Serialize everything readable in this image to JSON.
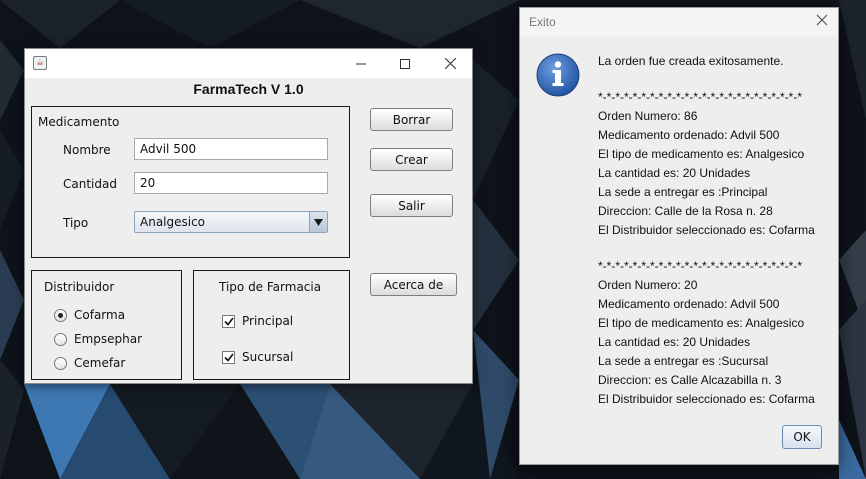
{
  "main_window": {
    "title": "FarmaTech V 1.0",
    "medicamento_group": {
      "title": "Medicamento",
      "nombre_label": "Nombre",
      "nombre_value": "Advil 500",
      "cantidad_label": "Cantidad",
      "cantidad_value": "20",
      "tipo_label": "Tipo",
      "tipo_value": "Analgesico"
    },
    "buttons": {
      "borrar": "Borrar",
      "crear": "Crear",
      "salir": "Salir",
      "acerca_de": "Acerca de"
    },
    "distribuidor_group": {
      "title": "Distribuidor",
      "options": [
        {
          "label": "Cofarma",
          "selected": true
        },
        {
          "label": "Empsephar",
          "selected": false
        },
        {
          "label": "Cemefar",
          "selected": false
        }
      ]
    },
    "farmacia_group": {
      "title": "Tipo de Farmacia",
      "options": [
        {
          "label": "Principal",
          "checked": true
        },
        {
          "label": "Sucursal",
          "checked": true
        }
      ]
    }
  },
  "dialog": {
    "title": "Exito",
    "icon": "information-icon",
    "lines": [
      "La orden fue creada exitosamente.",
      "*-*-*-*-*-*-*-*-*-*-*-*-*-*-*-*-*-*-*-*-*-*-*-*",
      "Orden Numero: 86",
      "Medicamento ordenado: Advil 500",
      "El tipo de medicamento es: Analgesico",
      "La cantidad es: 20 Unidades",
      "La sede a entregar es :Principal",
      "Direccion: Calle de la Rosa n. 28",
      "El Distribuidor seleccionado es: Cofarma",
      "*-*-*-*-*-*-*-*-*-*-*-*-*-*-*-*-*-*-*-*-*-*-*-*",
      "Orden Numero: 20",
      "Medicamento ordenado: Advil 500",
      "El tipo de medicamento es: Analgesico",
      "La cantidad es: 20 Unidades",
      "La sede a entregar es :Sucursal",
      "Direccion: es Calle Alcazabilla n. 3",
      "El Distribuidor seleccionado es: Cofarma"
    ],
    "ok_label": "OK"
  },
  "colors": {
    "wallpaper_dark": "#0d1218",
    "wallpaper_blue": "#3e78b3",
    "info_icon_blue": "#2f63b4",
    "window_bg": "#eeeeee"
  }
}
